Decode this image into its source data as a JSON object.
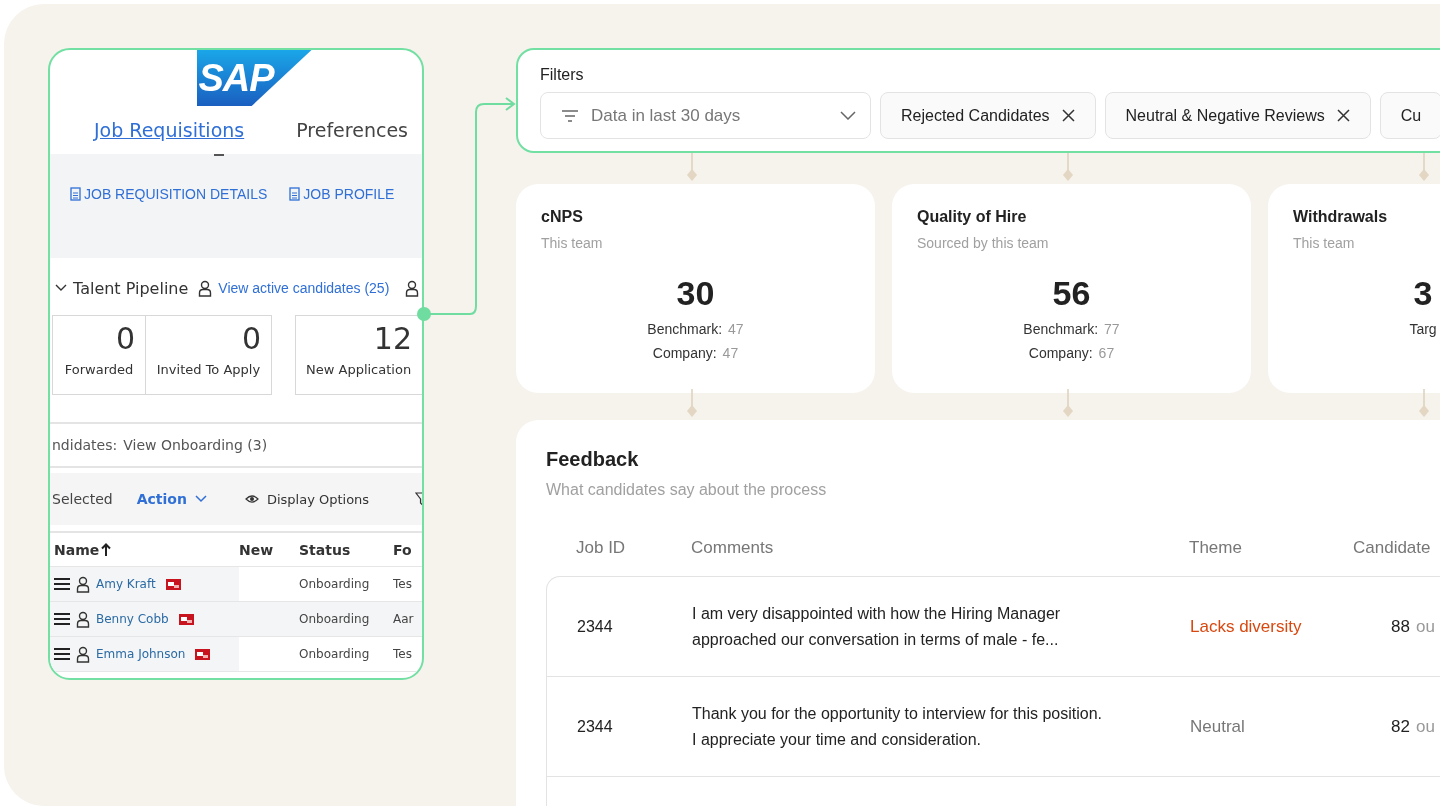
{
  "sap_panel": {
    "logo": "SAP",
    "tabs": [
      {
        "label": "Job Requisitions",
        "selected": true
      },
      {
        "label": "Preferences",
        "selected": false
      }
    ],
    "actions": [
      "JOB REQUISITION DETAILS",
      "JOB PROFILE"
    ],
    "pipeline": {
      "title": "Talent Pipeline",
      "link": "View active candidates (25)"
    },
    "tiles": [
      {
        "count": "0",
        "label": "Forwarded"
      },
      {
        "count": "0",
        "label": "Invited To Apply"
      },
      {
        "count": "12",
        "label": "New Application"
      }
    ],
    "onboarding": {
      "label": "ndidates:",
      "link": "View Onboarding (3)"
    },
    "toolbar": {
      "selected": "Selected",
      "action": "Action",
      "display": "Display Options"
    },
    "table": {
      "columns": [
        {
          "label": "Name",
          "sorted_ascending": true
        },
        {
          "label": "New",
          "sorted_ascending": false
        },
        {
          "label": "Status",
          "sorted_ascending": false
        },
        {
          "label": "Fo",
          "sorted_ascending": false
        }
      ],
      "rows": [
        {
          "name": "Amy Kraft",
          "status": "Onboarding",
          "column_4": "Tes"
        },
        {
          "name": "Benny Cobb",
          "status": "Onboarding",
          "column_4": "Aar"
        },
        {
          "name": "Emma Johnson",
          "status": "Onboarding",
          "column_4": "Tes"
        }
      ]
    }
  },
  "filters": {
    "title": "Filters",
    "range": "Data in last 30 days",
    "chips": [
      {
        "label": "Rejected Candidates",
        "removable": true
      },
      {
        "label": "Neutral & Negative Reviews",
        "removable": true
      },
      {
        "label": "Cu",
        "removable": false
      }
    ]
  },
  "metrics": [
    {
      "title": "cNPS",
      "subtitle": "This team",
      "value": "30",
      "rows": [
        {
          "label": "Benchmark:",
          "value": "47"
        },
        {
          "label": "Company:",
          "value": "47"
        }
      ]
    },
    {
      "title": "Quality of Hire",
      "subtitle": "Sourced by this team",
      "value": "56",
      "rows": [
        {
          "label": "Benchmark:",
          "value": "77"
        },
        {
          "label": "Company:",
          "value": "67"
        }
      ]
    },
    {
      "title": "Withdrawals",
      "subtitle": "This team",
      "value": "3",
      "rows": [
        {
          "label": "Targ"
        }
      ]
    }
  ],
  "feedback": {
    "title": "Feedback",
    "subtitle": "What candidates say about the process",
    "columns": [
      "Job ID",
      "Comments",
      "Theme",
      "Candidate"
    ],
    "rows": [
      {
        "job_id": "2344",
        "comment_lines": [
          "I am very disappointed with how the Hiring Manager",
          "approached our conversation in terms of male - fe..."
        ],
        "theme": "Lacks diversity",
        "color": "#d9480f",
        "score": "88",
        "score_suffix": "ou"
      },
      {
        "job_id": "2344",
        "comment_lines": [
          "Thank you for the opportunity to interview for this position.",
          "I appreciate your time and consideration."
        ],
        "theme": "Neutral",
        "color": "#777777",
        "score": "82",
        "score_suffix": "ou"
      }
    ]
  }
}
